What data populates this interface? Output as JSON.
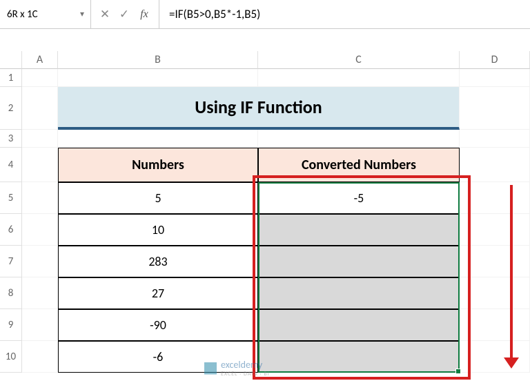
{
  "name_box": "6R x 1C",
  "formula": "=IF(B5>0,B5*-1,B5)",
  "columns": {
    "A": "A",
    "B": "B",
    "C": "C",
    "D": "D"
  },
  "rownums": [
    "1",
    "2",
    "3",
    "4",
    "5",
    "6",
    "7",
    "8",
    "9",
    "10"
  ],
  "title": "Using IF Function",
  "headers": {
    "numbers": "Numbers",
    "converted": "Converted Numbers"
  },
  "data": {
    "b5": "5",
    "b6": "10",
    "b7": "283",
    "b8": "27",
    "b9": "-90",
    "b10": "-6",
    "c5": "-5",
    "c6": "",
    "c7": "",
    "c8": "",
    "c9": "",
    "c10": ""
  },
  "watermark": {
    "name": "exceldemy",
    "sub": "EXCEL · DATA · BI"
  },
  "icons": {
    "chevron": "▾",
    "cancel": "✕",
    "confirm": "✓",
    "fx": "fx"
  },
  "chart_data": {
    "type": "table",
    "title": "Using IF Function",
    "columns": [
      "Numbers",
      "Converted Numbers"
    ],
    "rows": [
      [
        5,
        -5
      ],
      [
        10,
        null
      ],
      [
        283,
        null
      ],
      [
        27,
        null
      ],
      [
        -90,
        null
      ],
      [
        -6,
        null
      ]
    ],
    "formula_C5": "=IF(B5>0,B5*-1,B5)"
  }
}
